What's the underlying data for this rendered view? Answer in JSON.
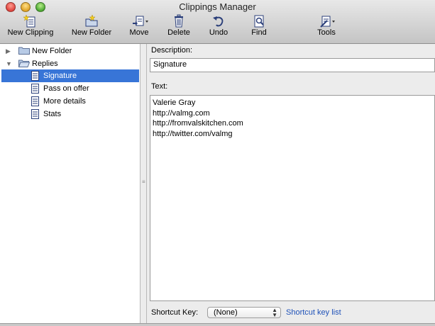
{
  "window": {
    "title": "Clippings Manager"
  },
  "toolbar": {
    "buttons": [
      {
        "label": "New Clipping",
        "icon": "new-clipping-icon"
      },
      {
        "label": "New Folder",
        "icon": "new-folder-icon"
      },
      {
        "label": "Move",
        "icon": "move-icon"
      },
      {
        "label": "Delete",
        "icon": "trash-icon"
      },
      {
        "label": "Undo",
        "icon": "undo-icon"
      },
      {
        "label": "Find",
        "icon": "find-icon"
      },
      {
        "label": "Tools",
        "icon": "tools-icon"
      }
    ]
  },
  "tree": {
    "items": [
      {
        "label": "New Folder",
        "type": "folder",
        "expanded": false
      },
      {
        "label": "Replies",
        "type": "folder",
        "expanded": true
      },
      {
        "label": "Signature",
        "type": "clipping",
        "selected": true
      },
      {
        "label": "Pass on offer",
        "type": "clipping"
      },
      {
        "label": "More details",
        "type": "clipping"
      },
      {
        "label": "Stats",
        "type": "clipping"
      }
    ]
  },
  "editor": {
    "description_label": "Description:",
    "description_value": "Signature",
    "text_label": "Text:",
    "text_lines": [
      "Valerie Gray",
      "http://valmg.com",
      "http://fromvalskitchen.com",
      "http://twitter.com/valmg"
    ],
    "shortcut_label": "Shortcut Key:",
    "shortcut_value": "(None)",
    "shortcut_link": "Shortcut key list"
  },
  "colors": {
    "selection": "#3875d7",
    "link": "#1e51b8"
  }
}
